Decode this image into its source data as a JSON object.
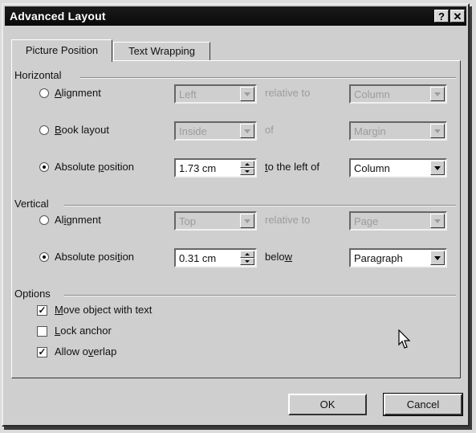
{
  "dialog": {
    "title": "Advanced Layout",
    "help_label": "?",
    "close_label": "✕"
  },
  "tabs": [
    {
      "label": "Picture Position",
      "active": true
    },
    {
      "label": "Text Wrapping",
      "active": false
    }
  ],
  "horizontal": {
    "section_label": "Horizontal",
    "alignment": {
      "label": "Alignment",
      "selected": false,
      "value": "Left",
      "relative_label": "relative to",
      "relative_value": "Column"
    },
    "book_layout": {
      "label": "Book layout",
      "selected": false,
      "value": "Inside",
      "of_label": "of",
      "of_value": "Margin"
    },
    "absolute": {
      "label": "Absolute position",
      "selected": true,
      "value": "1.73 cm",
      "relative_label": "to the left of",
      "relative_value": "Column"
    }
  },
  "vertical": {
    "section_label": "Vertical",
    "alignment": {
      "label": "Alignment",
      "selected": false,
      "value": "Top",
      "relative_label": "relative to",
      "relative_value": "Page"
    },
    "absolute": {
      "label": "Absolute position",
      "selected": true,
      "value": "0.31 cm",
      "relative_label": "below",
      "relative_value": "Paragraph"
    }
  },
  "options": {
    "section_label": "Options",
    "move_with_text": {
      "label": "Move object with text",
      "checked": true
    },
    "lock_anchor": {
      "label": "Lock anchor",
      "checked": false
    },
    "allow_overlap": {
      "label": "Allow overlap",
      "checked": true
    }
  },
  "buttons": {
    "ok": "OK",
    "cancel": "Cancel"
  },
  "colors": {
    "titlebar": "#0a0a0a",
    "face": "#cfcfcf",
    "disabled_text": "#9c9c9c"
  }
}
